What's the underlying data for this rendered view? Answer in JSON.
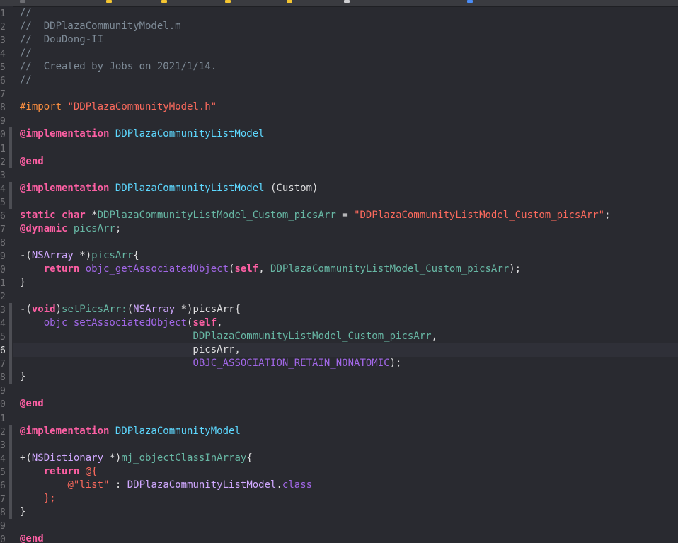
{
  "editor": {
    "line_numbers": [
      "1",
      "2",
      "3",
      "4",
      "5",
      "6",
      "7",
      "8",
      "9",
      "0",
      "1",
      "2",
      "3",
      "4",
      "5",
      "6",
      "7",
      "8",
      "9",
      "0",
      "1",
      "2",
      "3",
      "4",
      "5",
      "6",
      "7",
      "8",
      "9",
      "0",
      "1",
      "2",
      "3",
      "4",
      "5",
      "6",
      "7",
      "8",
      "9",
      "0"
    ],
    "current_line_index": 25,
    "lines": [
      [
        {
          "t": "//",
          "c": "comment"
        }
      ],
      [
        {
          "t": "//  DDPlazaCommunityModel.m",
          "c": "comment"
        }
      ],
      [
        {
          "t": "//  DouDong-II",
          "c": "comment"
        }
      ],
      [
        {
          "t": "//",
          "c": "comment"
        }
      ],
      [
        {
          "t": "//  Created by Jobs on 2021/1/14.",
          "c": "comment"
        }
      ],
      [
        {
          "t": "//",
          "c": "comment"
        }
      ],
      [],
      [
        {
          "t": "#import ",
          "c": "pre"
        },
        {
          "t": "\"DDPlazaCommunityModel.h\"",
          "c": "str"
        }
      ],
      [],
      [
        {
          "t": "@implementation ",
          "c": "kw"
        },
        {
          "t": "DDPlazaCommunityListModel",
          "c": "type"
        }
      ],
      [],
      [
        {
          "t": "@end",
          "c": "kw"
        }
      ],
      [],
      [
        {
          "t": "@implementation ",
          "c": "kw"
        },
        {
          "t": "DDPlazaCommunityListModel",
          "c": "type"
        },
        {
          "t": " (Custom)",
          "c": "plain"
        }
      ],
      [],
      [
        {
          "t": "static ",
          "c": "kw"
        },
        {
          "t": "char ",
          "c": "kw"
        },
        {
          "t": "*",
          "c": "plain"
        },
        {
          "t": "DDPlazaCommunityListModel_Custom_picsArr",
          "c": "fnP"
        },
        {
          "t": " = ",
          "c": "plain"
        },
        {
          "t": "\"DDPlazaCommunityListModel_Custom_picsArr\"",
          "c": "str"
        },
        {
          "t": ";",
          "c": "plain"
        }
      ],
      [
        {
          "t": "@dynamic ",
          "c": "kw"
        },
        {
          "t": "picsArr",
          "c": "fnP"
        },
        {
          "t": ";",
          "c": "plain"
        }
      ],
      [],
      [
        {
          "t": "-(",
          "c": "plain"
        },
        {
          "t": "NSArray",
          "c": "typeP"
        },
        {
          "t": " *)",
          "c": "plain"
        },
        {
          "t": "picsArr",
          "c": "fnP"
        },
        {
          "t": "{",
          "c": "plain"
        }
      ],
      [
        {
          "t": "    ",
          "c": "plain"
        },
        {
          "t": "return ",
          "c": "kw"
        },
        {
          "t": "objc_getAssociatedObject",
          "c": "fn"
        },
        {
          "t": "(",
          "c": "plain"
        },
        {
          "t": "self",
          "c": "kw"
        },
        {
          "t": ", ",
          "c": "plain"
        },
        {
          "t": "DDPlazaCommunityListModel_Custom_picsArr",
          "c": "fnP"
        },
        {
          "t": ");",
          "c": "plain"
        }
      ],
      [
        {
          "t": "}",
          "c": "plain"
        }
      ],
      [],
      [
        {
          "t": "-(",
          "c": "plain"
        },
        {
          "t": "void",
          "c": "kw"
        },
        {
          "t": ")",
          "c": "plain"
        },
        {
          "t": "setPicsArr:",
          "c": "fnP"
        },
        {
          "t": "(",
          "c": "plain"
        },
        {
          "t": "NSArray",
          "c": "typeP"
        },
        {
          "t": " *)picsArr{",
          "c": "plain"
        }
      ],
      [
        {
          "t": "    ",
          "c": "plain"
        },
        {
          "t": "objc_setAssociatedObject",
          "c": "fn"
        },
        {
          "t": "(",
          "c": "plain"
        },
        {
          "t": "self",
          "c": "kw"
        },
        {
          "t": ",",
          "c": "plain"
        }
      ],
      [
        {
          "t": "                             ",
          "c": "plain"
        },
        {
          "t": "DDPlazaCommunityListModel_Custom_picsArr",
          "c": "fnP"
        },
        {
          "t": ",",
          "c": "plain"
        }
      ],
      [
        {
          "t": "                             picsArr,",
          "c": "plain"
        }
      ],
      [
        {
          "t": "                             ",
          "c": "plain"
        },
        {
          "t": "OBJC_ASSOCIATION_RETAIN_NONATOMIC",
          "c": "const"
        },
        {
          "t": ");",
          "c": "plain"
        }
      ],
      [
        {
          "t": "}",
          "c": "plain"
        }
      ],
      [],
      [
        {
          "t": "@end",
          "c": "kw"
        }
      ],
      [],
      [
        {
          "t": "@implementation ",
          "c": "kw"
        },
        {
          "t": "DDPlazaCommunityModel",
          "c": "type"
        }
      ],
      [],
      [
        {
          "t": "+(",
          "c": "plain"
        },
        {
          "t": "NSDictionary",
          "c": "typeP"
        },
        {
          "t": " *)",
          "c": "plain"
        },
        {
          "t": "mj_objectClassInArray",
          "c": "fnP"
        },
        {
          "t": "{",
          "c": "plain"
        }
      ],
      [
        {
          "t": "    ",
          "c": "plain"
        },
        {
          "t": "return ",
          "c": "kw"
        },
        {
          "t": "@{",
          "c": "str"
        }
      ],
      [
        {
          "t": "        ",
          "c": "plain"
        },
        {
          "t": "@\"list\"",
          "c": "str"
        },
        {
          "t": " : ",
          "c": "plain"
        },
        {
          "t": "DDPlazaCommunityListModel",
          "c": "typeP"
        },
        {
          "t": ".",
          "c": "plain"
        },
        {
          "t": "class",
          "c": "fn"
        }
      ],
      [
        {
          "t": "    ",
          "c": "plain"
        },
        {
          "t": "};",
          "c": "str"
        }
      ],
      [
        {
          "t": "}",
          "c": "plain"
        }
      ],
      [],
      [
        {
          "t": "@end",
          "c": "kw"
        }
      ]
    ]
  },
  "colors": {
    "background": "#292a30",
    "comment": "#7f8c98",
    "keyword": "#fc5fa3",
    "string": "#fc6a5d",
    "preprocessor": "#fd8f3f",
    "type_declared": "#5dd8ff",
    "type_project": "#d0a8ff",
    "function_system": "#a167e6",
    "function_project": "#67b7a4",
    "plain": "#dfdfe0"
  }
}
